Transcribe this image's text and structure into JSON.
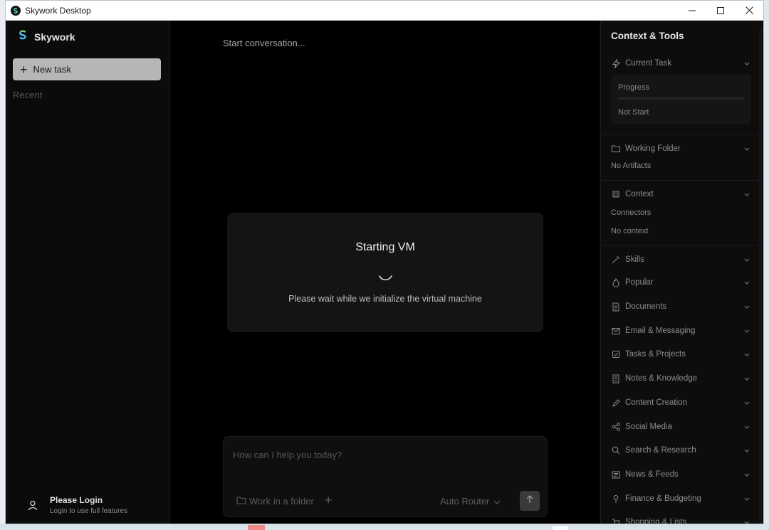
{
  "window": {
    "title": "Skywork Desktop"
  },
  "sidebar": {
    "brand": "Skywork",
    "new_task_label": "New task",
    "recent_label": "Recent",
    "login": {
      "title": "Please Login",
      "subtitle": "Login to use full features"
    }
  },
  "main": {
    "start_conversation": "Start conversation...",
    "vm": {
      "title": "Starting VM",
      "subtitle": "Please wait while we initialize the virtual machine"
    },
    "composer": {
      "placeholder": "How can I help you today?",
      "folder_label": "Work in a folder",
      "router_label": "Auto Router"
    }
  },
  "right_panel": {
    "title": "Context & Tools",
    "current_task": {
      "label": "Current Task",
      "progress_label": "Progress",
      "progress": 0,
      "status": "Not Start"
    },
    "working_folder": {
      "label": "Working Folder",
      "empty": "No Artifacts"
    },
    "context": {
      "label": "Context",
      "connectors": "Connectors",
      "empty": "No context"
    },
    "skills": [
      {
        "label": "Skills",
        "icon": "magic-wand-icon"
      },
      {
        "label": "Popular",
        "icon": "flame-icon"
      },
      {
        "label": "Documents",
        "icon": "document-icon"
      },
      {
        "label": "Email & Messaging",
        "icon": "mail-icon"
      },
      {
        "label": "Tasks & Projects",
        "icon": "checkbox-icon"
      },
      {
        "label": "Notes & Knowledge",
        "icon": "notebook-icon"
      },
      {
        "label": "Content Creation",
        "icon": "pen-icon"
      },
      {
        "label": "Social Media",
        "icon": "share-icon"
      },
      {
        "label": "Search & Research",
        "icon": "search-icon"
      },
      {
        "label": "News & Feeds",
        "icon": "newspaper-icon"
      },
      {
        "label": "Finance & Budgeting",
        "icon": "pin-icon"
      },
      {
        "label": "Shopping & Lists",
        "icon": "cart-icon"
      }
    ]
  }
}
